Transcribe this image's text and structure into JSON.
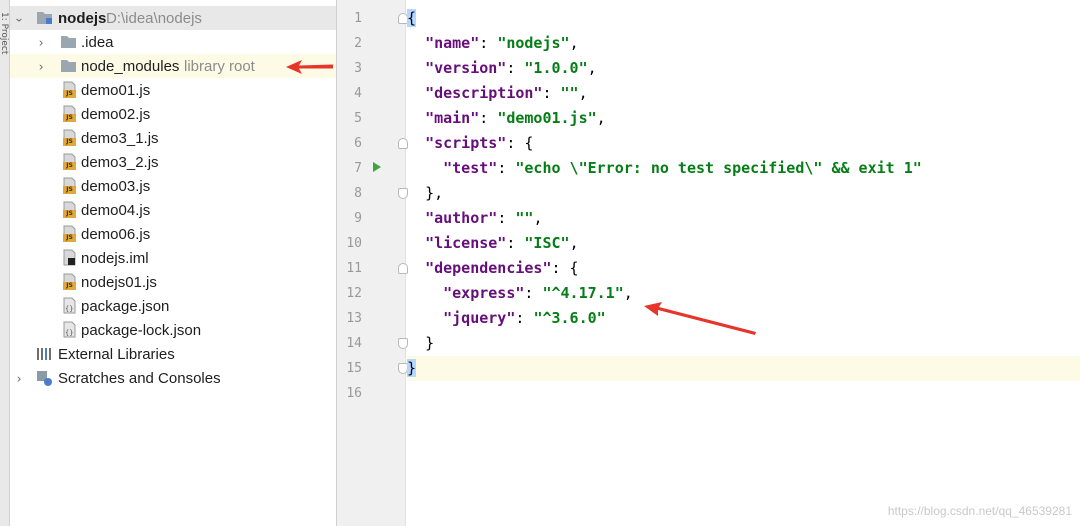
{
  "strip_label": "1: Project",
  "tree": {
    "root": {
      "name": "nodejs",
      "path": "D:\\idea\\nodejs"
    },
    "items": [
      {
        "label": "idea_prefix",
        "text": ".idea"
      },
      {
        "text": "node_modules",
        "hint": "library root"
      },
      {
        "text": "demo01.js"
      },
      {
        "text": "demo02.js"
      },
      {
        "text": "demo3_1.js"
      },
      {
        "text": "demo3_2.js"
      },
      {
        "text": "demo03.js"
      },
      {
        "text": "demo04.js"
      },
      {
        "text": "demo06.js"
      },
      {
        "text": "nodejs.iml"
      },
      {
        "text": "nodejs01.js"
      },
      {
        "text": "package.json"
      },
      {
        "text": "package-lock.json"
      }
    ],
    "external_libraries": "External Libraries",
    "scratches": "Scratches and Consoles"
  },
  "editor": {
    "line_numbers": [
      "1",
      "2",
      "3",
      "4",
      "5",
      "6",
      "7",
      "8",
      "9",
      "10",
      "11",
      "12",
      "13",
      "14",
      "15",
      "16"
    ],
    "code": {
      "l1_open": "{",
      "name_key": "\"name\"",
      "name_val": "\"nodejs\"",
      "version_key": "\"version\"",
      "version_val": "\"1.0.0\"",
      "description_key": "\"description\"",
      "description_val": "\"\"",
      "main_key": "\"main\"",
      "main_val": "\"demo01.js\"",
      "scripts_key": "\"scripts\"",
      "test_key": "\"test\"",
      "test_val": "\"echo \\\"Error: no test specified\\\" && exit 1\"",
      "author_key": "\"author\"",
      "author_val": "\"\"",
      "license_key": "\"license\"",
      "license_val": "\"ISC\"",
      "deps_key": "\"dependencies\"",
      "express_key": "\"express\"",
      "express_val": "\"^4.17.1\"",
      "jquery_key": "\"jquery\"",
      "jquery_val": "\"^3.6.0\"",
      "close_inner": "}",
      "close_outer": "}"
    }
  },
  "watermark": "https://blog.csdn.net/qq_46539281",
  "colors": {
    "key": "#660e7a",
    "string": "#067d17",
    "annotation_arrow": "#e8352b"
  }
}
